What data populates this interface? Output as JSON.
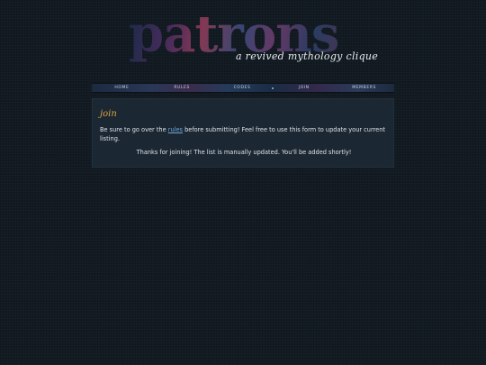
{
  "header": {
    "title": "patrons",
    "tagline": "a revived mythology clique"
  },
  "nav": {
    "items": [
      {
        "label": "HOME"
      },
      {
        "label": "RULES"
      },
      {
        "label": "CODES"
      },
      {
        "label": "JOIN"
      },
      {
        "label": "MEMBERS"
      }
    ]
  },
  "main": {
    "heading": "join",
    "intro_before": "Be sure to go over the ",
    "rules_link": "rules",
    "intro_after": " before submitting! Feel free to use this form to update your current listing.",
    "thanks": "Thanks for joining! The list is manually updated. You'll be added shortly!"
  },
  "colors": {
    "background": "#121a22",
    "panel": "#1b2733",
    "heading": "#d9a441",
    "link": "#6fa9d6"
  }
}
